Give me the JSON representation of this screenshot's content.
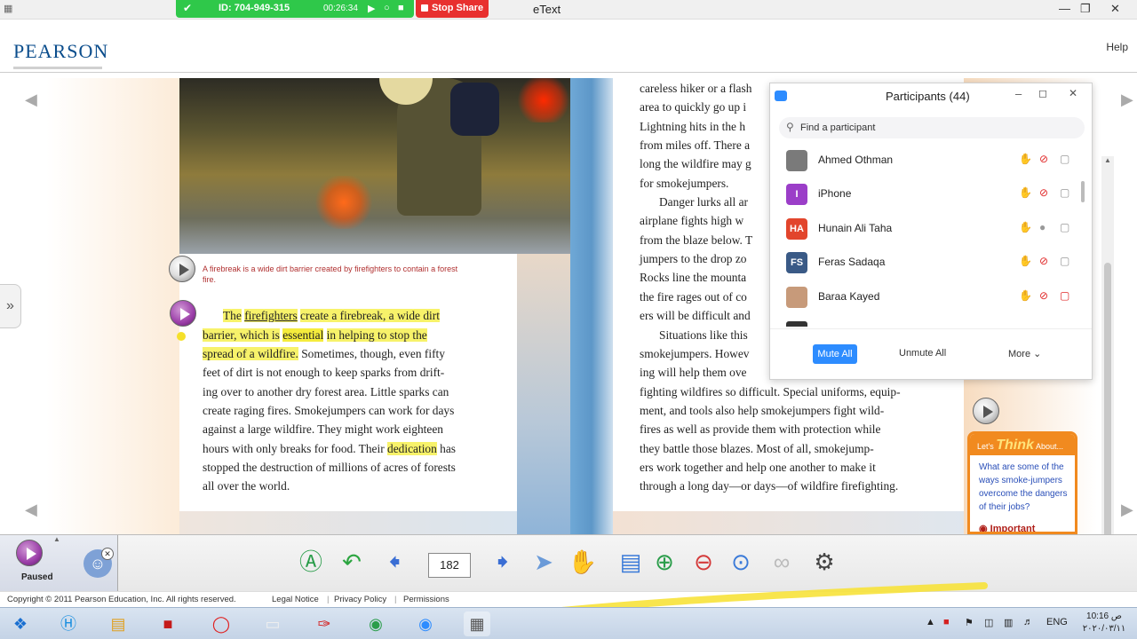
{
  "titlebar": {
    "title": "eText",
    "zoom_id": "ID: 704-949-315",
    "zoom_timer": "00:26:34",
    "stop_share": "Stop Share"
  },
  "header": {
    "logo": "PEARSON",
    "help": "Help"
  },
  "book": {
    "caption": "A firebreak is a wide dirt barrier created by firefighters to contain a forest fire.",
    "left_lines": [
      "barrier, which is",
      "essential",
      "in helping to stop the",
      "spread of a wildfire.",
      "Sometimes, though, even fifty",
      "feet of dirt is not enough to keep sparks from drift-",
      "ing over to another dry forest area. Little sparks can",
      "create raging fires. Smokejumpers can work for days",
      "against a large wildfire. They might work eighteen",
      "hours with only breaks for food. Their",
      "dedication",
      "has",
      "stopped the destruction of millions of acres of forests",
      "all over the world."
    ],
    "first_line": {
      "w1": "The",
      "w2": "firefighters",
      "rest": "create a firebreak, a wide dirt"
    },
    "right_lines": [
      "careless hiker or a flash",
      "area to quickly go up i",
      "Lightning hits in the h",
      "from miles off. There a",
      "long the wildfire may g",
      "for smokejumpers.",
      "Danger lurks all ar",
      "airplane fights high w",
      "from the blaze below. T",
      "jumpers to the drop zo",
      "Rocks line the mounta",
      "the fire rages out of co",
      "ers will be difficult and",
      "Situations like this",
      "smokejumpers. Howev",
      "ing will help them ove",
      "fighting wildfires so difficult. Special uniforms, equip-",
      "ment, and tools also help smokejumpers fight wild-",
      "fires as well as provide them with protection while",
      "they battle those blazes. Most of all, smokejump-",
      "ers work together and help one another to make it",
      "through a long day—or days—of wildfire firefighting."
    ],
    "think": {
      "lead": "Let's",
      "big": "Think",
      "tail": "About...",
      "question": "What are some of the ways smoke-jumpers overcome the dangers of their jobs?",
      "important": "Important"
    }
  },
  "participants": {
    "title": "Participants (44)",
    "search_placeholder": "Find a participant",
    "rows": [
      {
        "name": "Ahmed Othman",
        "initials": "",
        "color": "#7a7a7a"
      },
      {
        "name": "iPhone",
        "initials": "I",
        "color": "#9b3ec8"
      },
      {
        "name": "Hunain Ali Taha",
        "initials": "HA",
        "color": "#e2452c"
      },
      {
        "name": "Feras Sadaqa",
        "initials": "FS",
        "color": "#3a5a86"
      },
      {
        "name": "Baraa Kayed",
        "initials": "",
        "color": "#c79a7a"
      }
    ],
    "mute_all": "Mute All",
    "unmute_all": "Unmute All",
    "more": "More"
  },
  "toolbar": {
    "audio_status": "Paused",
    "page_number": "182"
  },
  "footer": {
    "copyright": "Copyright © 2011 Pearson Education, Inc. All rights reserved.",
    "legal": "Legal Notice",
    "privacy": "Privacy Policy",
    "permissions": "Permissions"
  },
  "taskbar": {
    "lang": "ENG",
    "time": "10:16 ص",
    "date": "٢٠٢٠/٠٣/١١"
  }
}
